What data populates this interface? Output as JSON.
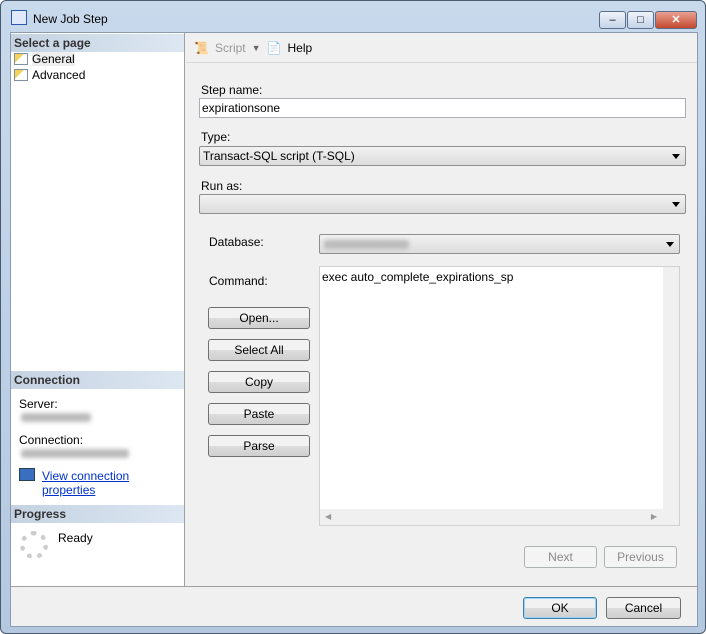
{
  "window": {
    "title": "New Job Step",
    "minimize": "–",
    "maximize": "□",
    "close": "✕"
  },
  "sidebar": {
    "select_header": "Select a page",
    "pages": [
      {
        "label": "General"
      },
      {
        "label": "Advanced"
      }
    ],
    "connection_header": "Connection",
    "server_label": "Server:",
    "connection_label": "Connection:",
    "view_props": "View connection properties",
    "progress_header": "Progress",
    "progress_status": "Ready"
  },
  "toolbar": {
    "script": "Script",
    "help": "Help"
  },
  "form": {
    "step_name_label": "Step name:",
    "step_name": "expirationsone",
    "type_label": "Type:",
    "type_value": "Transact-SQL script (T-SQL)",
    "run_as_label": "Run as:",
    "run_as_value": "",
    "database_label": "Database:",
    "command_label": "Command:",
    "command": "exec auto_complete_expirations_sp",
    "buttons": {
      "open": "Open...",
      "select_all": "Select All",
      "copy": "Copy",
      "paste": "Paste",
      "parse": "Parse"
    },
    "next": "Next",
    "previous": "Previous"
  },
  "footer": {
    "ok": "OK",
    "cancel": "Cancel"
  }
}
